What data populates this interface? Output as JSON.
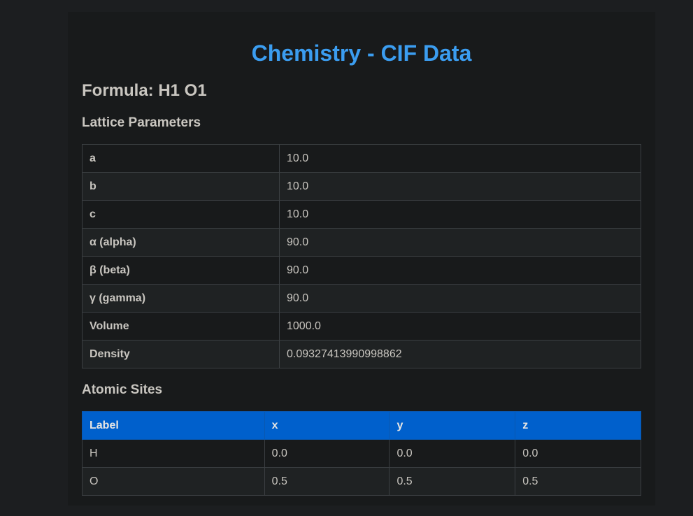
{
  "page": {
    "title": "Chemistry - CIF Data",
    "formula": "Formula: H1 O1"
  },
  "lattice": {
    "heading": "Lattice Parameters",
    "rows": [
      {
        "label": "a",
        "value": "10.0"
      },
      {
        "label": "b",
        "value": "10.0"
      },
      {
        "label": "c",
        "value": "10.0"
      },
      {
        "label": "α (alpha)",
        "value": "90.0"
      },
      {
        "label": "β (beta)",
        "value": "90.0"
      },
      {
        "label": "γ (gamma)",
        "value": "90.0"
      },
      {
        "label": "Volume",
        "value": "1000.0"
      },
      {
        "label": "Density",
        "value": "0.09327413990998862"
      }
    ]
  },
  "sites": {
    "heading": "Atomic Sites",
    "columns": [
      "Label",
      "x",
      "y",
      "z"
    ],
    "rows": [
      [
        "H",
        "0.0",
        "0.0",
        "0.0"
      ],
      [
        "O",
        "0.5",
        "0.5",
        "0.5"
      ]
    ]
  },
  "colors": {
    "title": "#3b9df0",
    "header_bg": "#0060cc",
    "background": "#1c1e20",
    "panel": "#181a1b"
  }
}
